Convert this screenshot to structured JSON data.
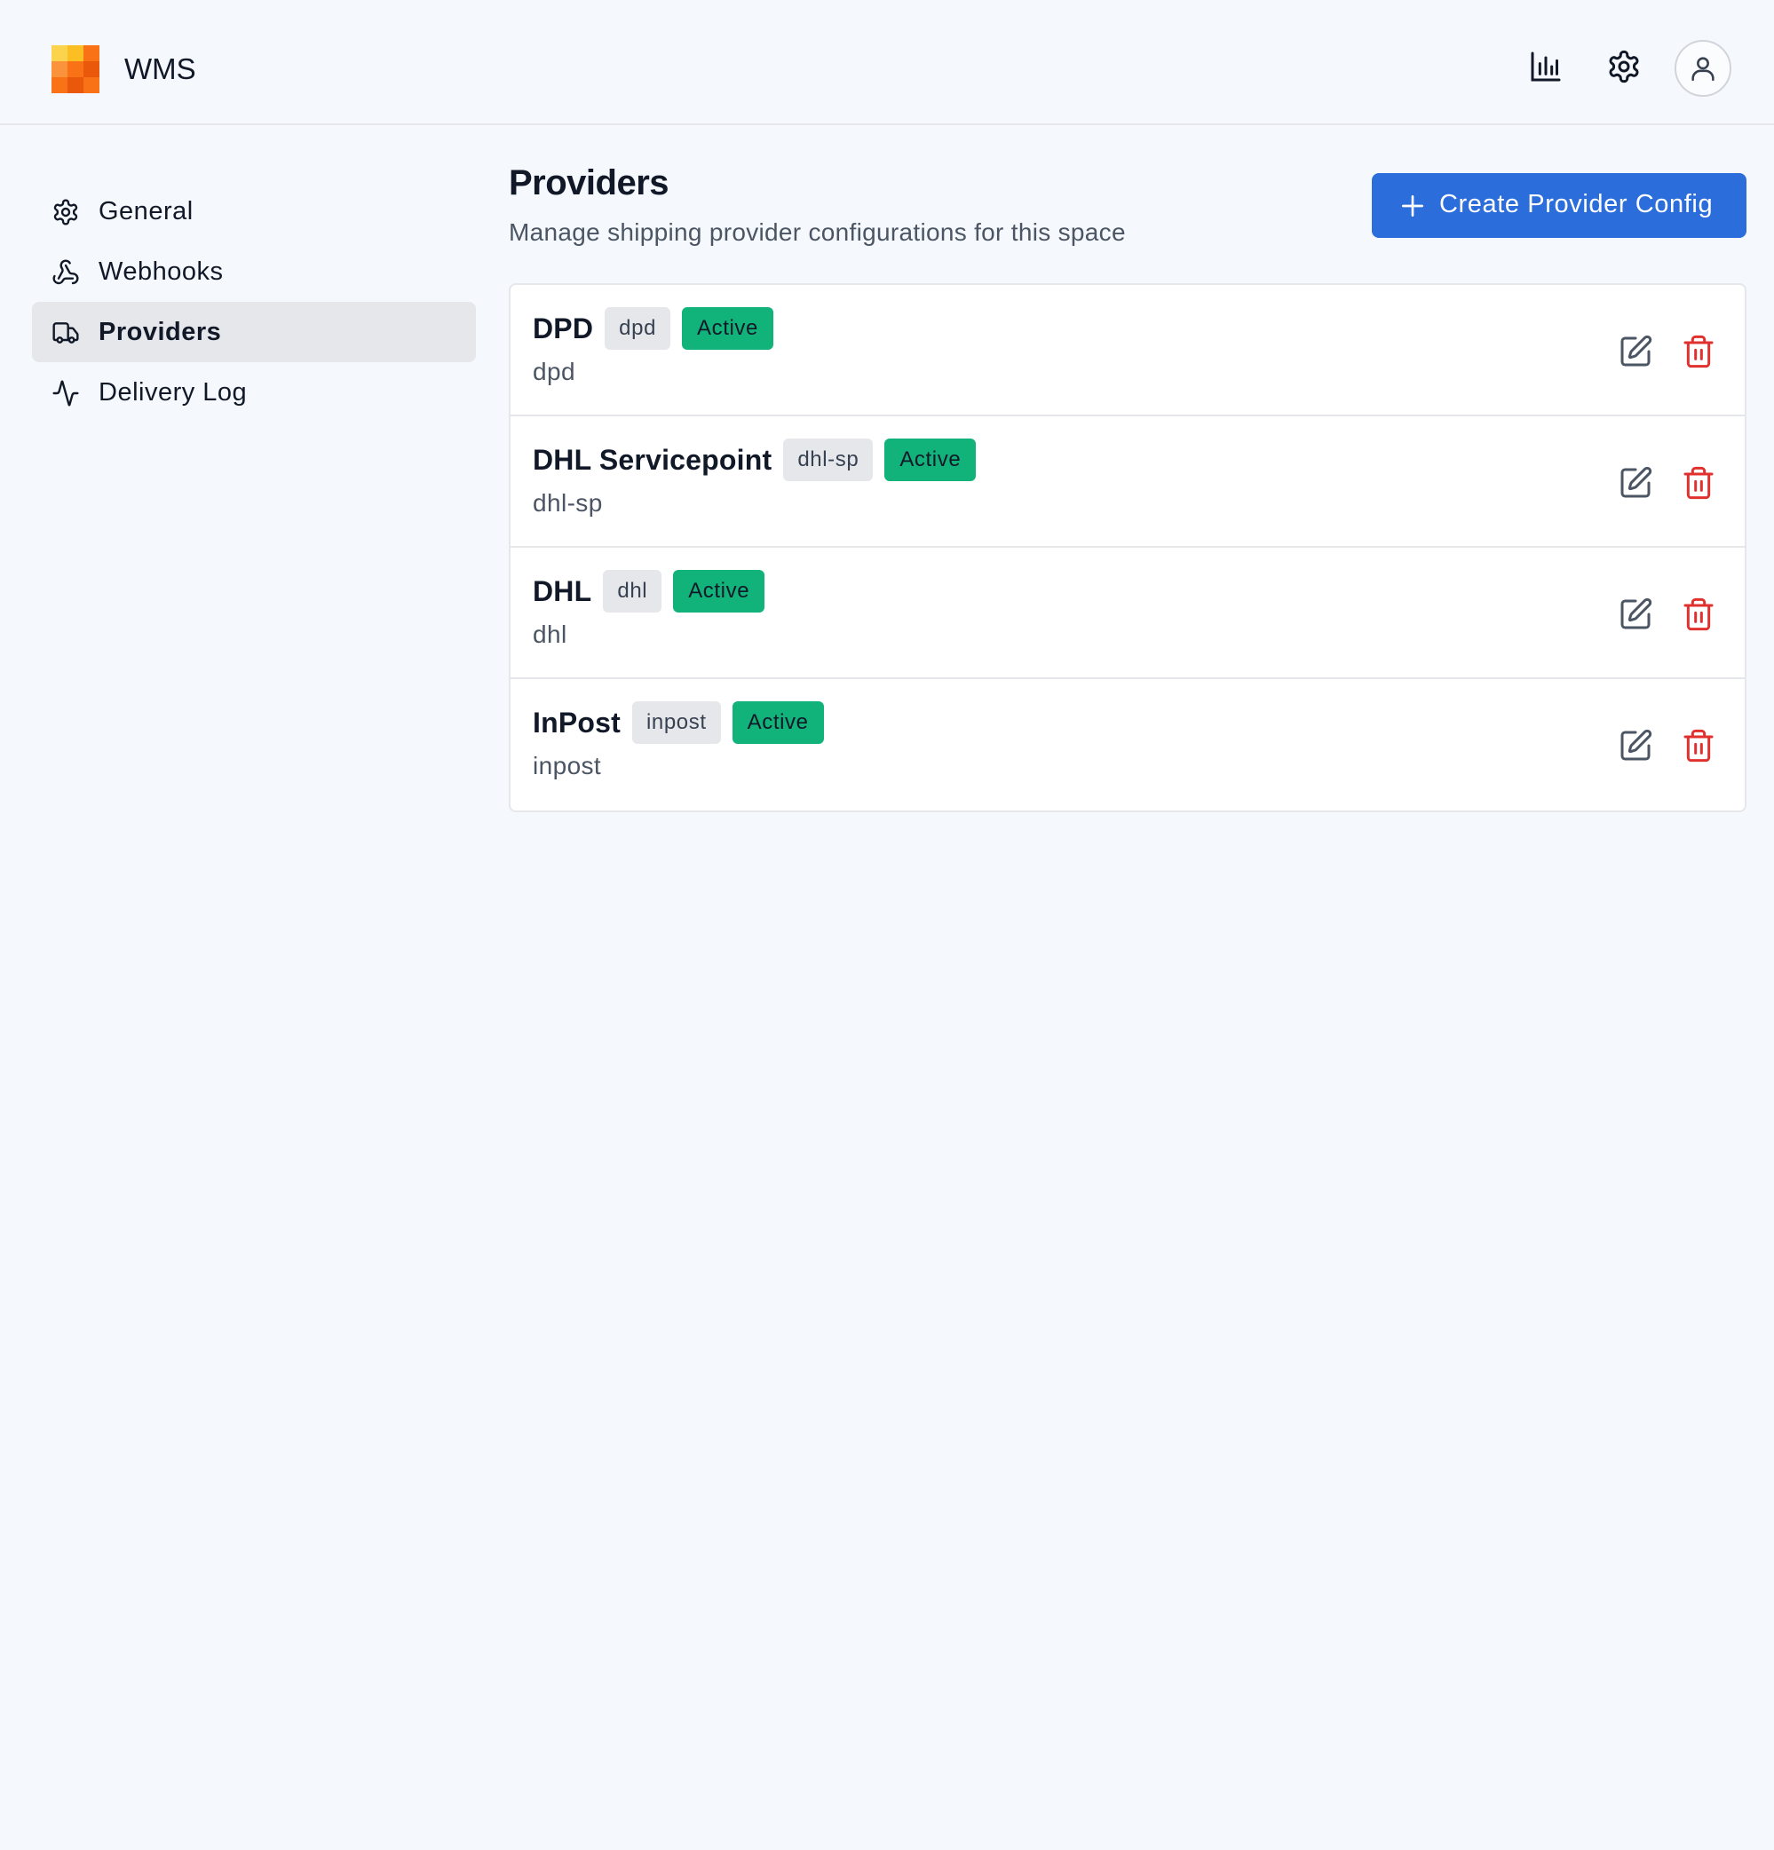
{
  "app": {
    "title": "WMS"
  },
  "topbar": {
    "icons": [
      "bar-chart-icon",
      "gear-icon",
      "user-icon"
    ]
  },
  "sidebar": {
    "items": [
      {
        "label": "General",
        "icon": "gear-icon",
        "active": false
      },
      {
        "label": "Webhooks",
        "icon": "webhook-icon",
        "active": false
      },
      {
        "label": "Providers",
        "icon": "truck-icon",
        "active": true
      },
      {
        "label": "Delivery Log",
        "icon": "activity-icon",
        "active": false
      }
    ]
  },
  "main": {
    "title": "Providers",
    "subtitle": "Manage shipping provider configurations for this space",
    "create_button": "Create Provider Config",
    "providers": [
      {
        "name": "DPD",
        "code": "dpd",
        "status": "Active",
        "subtitle": "dpd"
      },
      {
        "name": "DHL Servicepoint",
        "code": "dhl-sp",
        "status": "Active",
        "subtitle": "dhl-sp"
      },
      {
        "name": "DHL",
        "code": "dhl",
        "status": "Active",
        "subtitle": "dhl"
      },
      {
        "name": "InPost",
        "code": "inpost",
        "status": "Active",
        "subtitle": "inpost"
      }
    ]
  },
  "colors": {
    "accent": "#2b6ddb",
    "status_active": "#12b37a",
    "danger": "#e0312f",
    "background": "#f5f8fc"
  }
}
